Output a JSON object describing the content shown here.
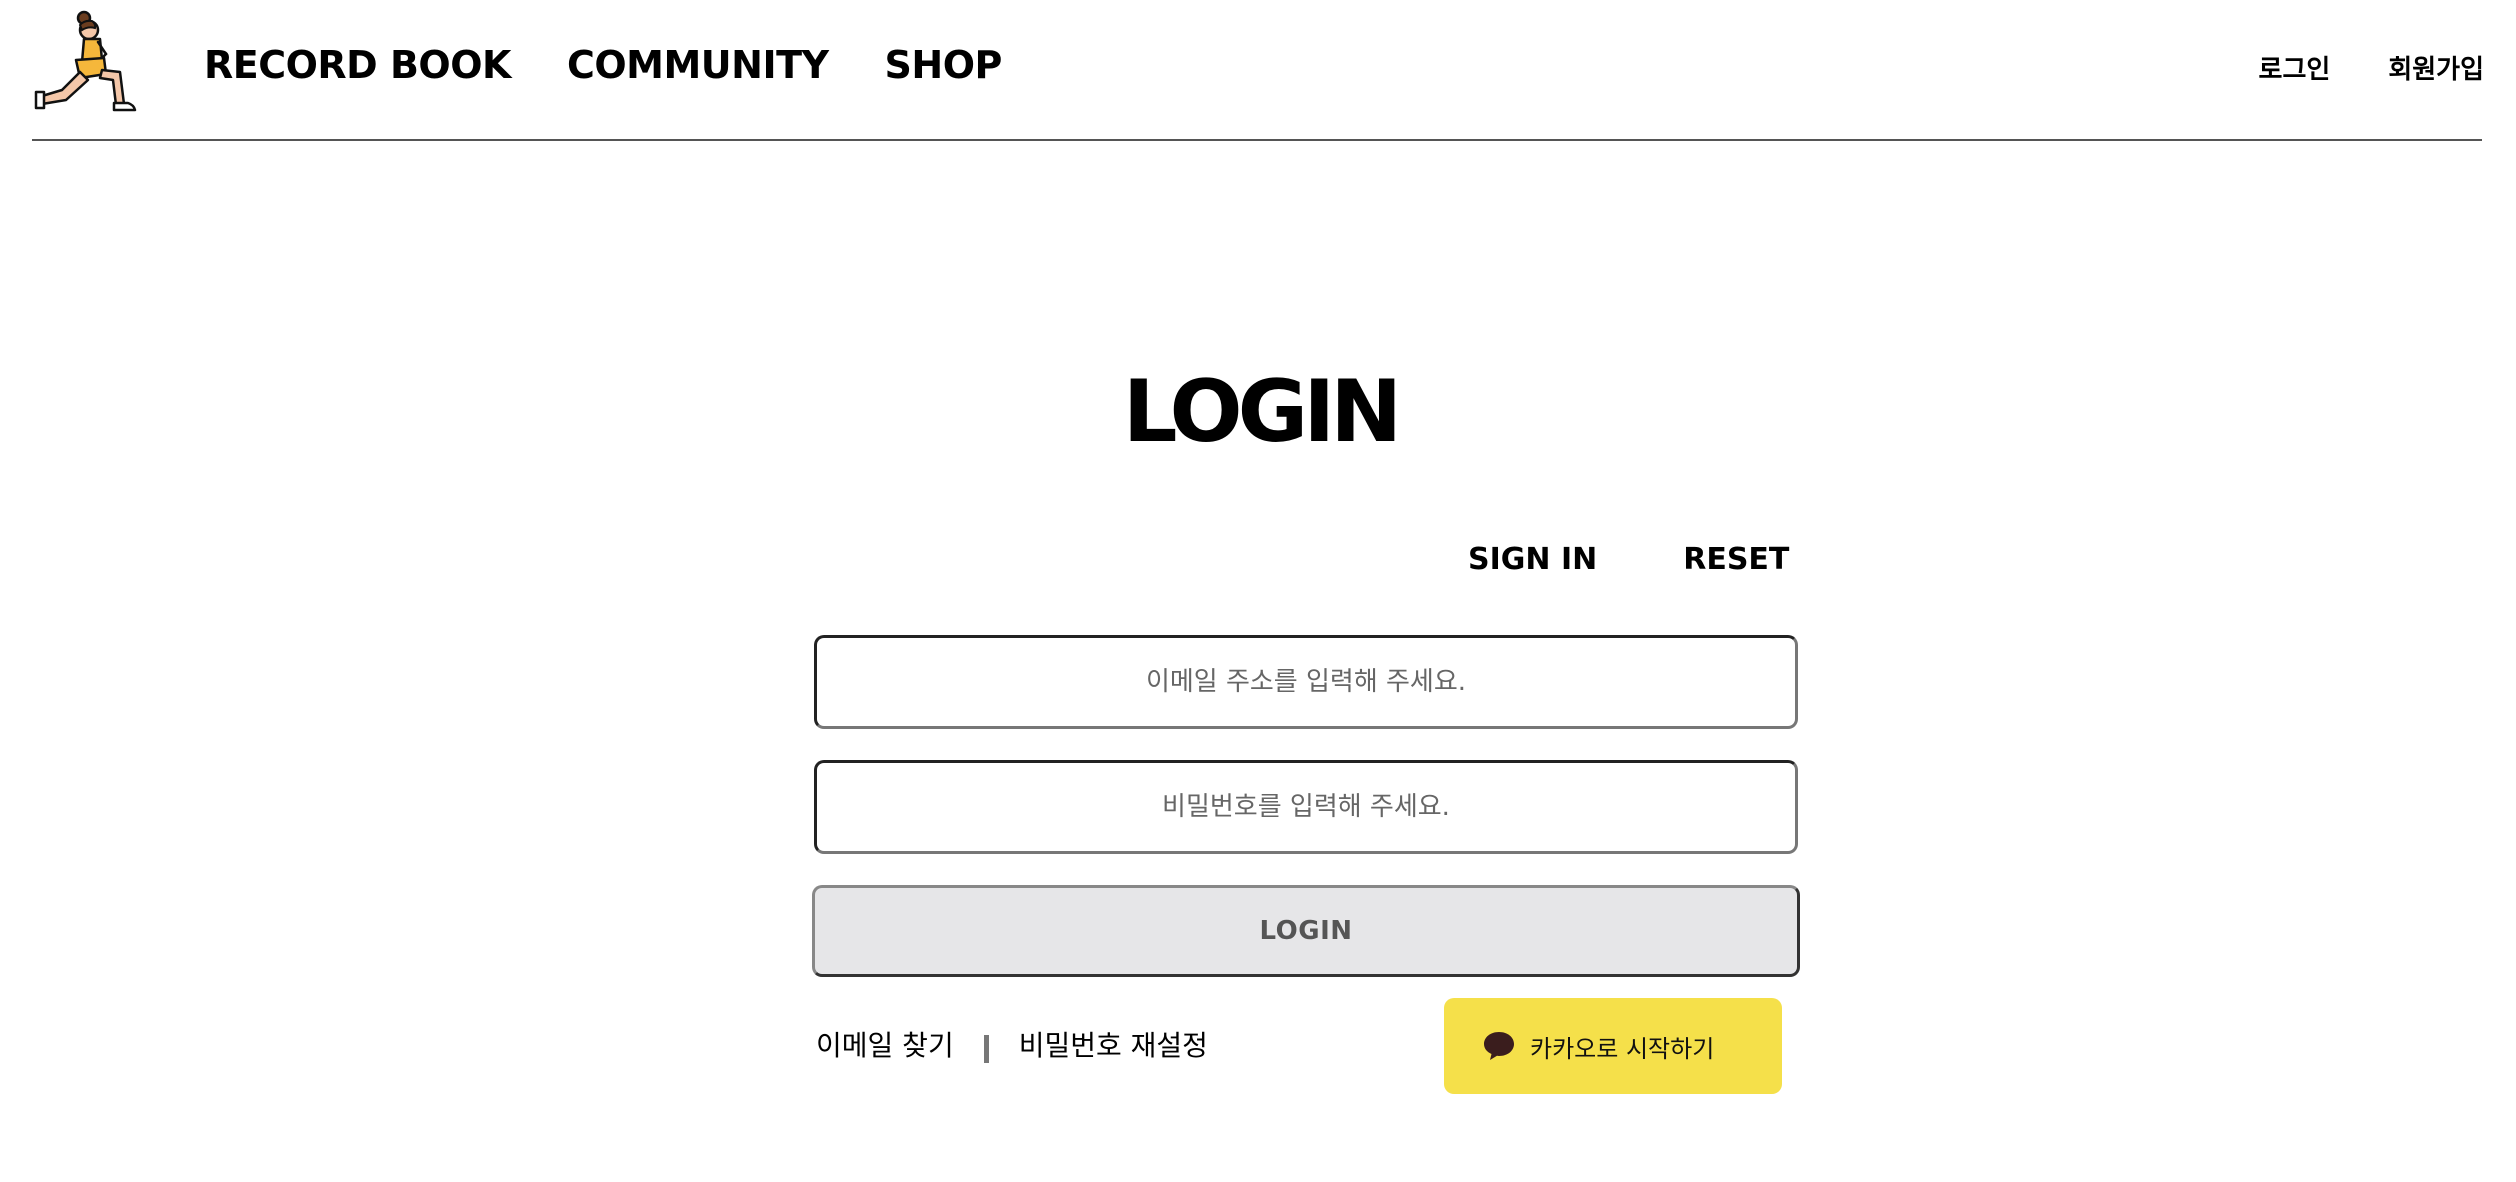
{
  "header": {
    "nav": [
      "RECORD BOOK",
      "COMMUNITY",
      "SHOP"
    ],
    "login_link": "로그인",
    "signup_link": "회원가입"
  },
  "main": {
    "title": "LOGIN",
    "tabs": [
      "SIGN IN",
      "RESET"
    ],
    "email_placeholder": "이메일 주소를 입력해 주세요.",
    "email_value": "",
    "password_placeholder": "비밀번호를 입력해 주세요.",
    "password_value": "",
    "login_button": "LOGIN",
    "find_email": "이메일 찾기",
    "reset_password": "비밀번호 재설정",
    "kakao_button": "카카오로 시작하기"
  },
  "colors": {
    "kakao_yellow": "#f5e04a",
    "login_button_bg": "#e6e6e8",
    "logo_orange": "#f5b73b",
    "logo_skin": "#f4c7a9"
  },
  "icons": {
    "logo": "lunging-woman-icon",
    "kakao": "speech-bubble-icon"
  }
}
